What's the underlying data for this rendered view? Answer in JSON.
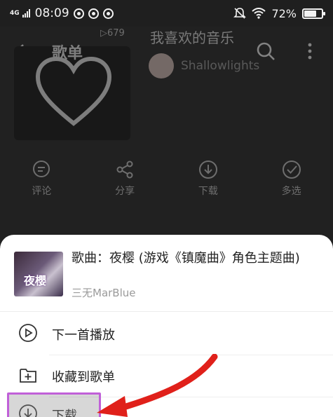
{
  "status_bar": {
    "network": "4G",
    "time": "08:09",
    "battery": "72%",
    "battery_level": 0.72
  },
  "background": {
    "header_title": "歌单",
    "play_count": "▷679",
    "playlist_name": "我喜欢的音乐",
    "owner": "Shallowlights",
    "actions": [
      {
        "label": "评论",
        "icon": "comment-icon"
      },
      {
        "label": "分享",
        "icon": "share-icon"
      },
      {
        "label": "下载",
        "icon": "download-icon"
      },
      {
        "label": "多选",
        "icon": "multi-select-icon"
      }
    ]
  },
  "sheet": {
    "song_title": "歌曲：夜樱 (游戏《镇魔曲》角色主题曲)",
    "artist": "三无MarBlue",
    "thumb_text": "夜櫻",
    "menu": [
      {
        "label": "下一首播放",
        "icon": "play-next-icon"
      },
      {
        "label": "收藏到歌单",
        "icon": "add-to-playlist-icon"
      },
      {
        "label": "下载",
        "icon": "download-icon"
      }
    ]
  },
  "annotation": {
    "highlight_color": "#c060d8",
    "arrow_color": "#e0201a"
  }
}
